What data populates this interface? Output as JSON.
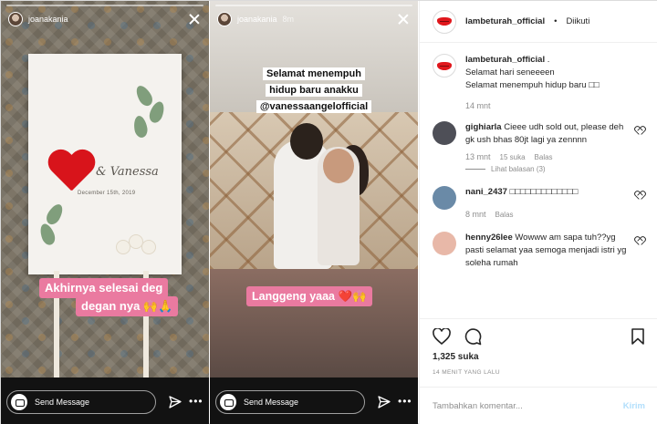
{
  "stories": [
    {
      "username": "joanakania",
      "time": "",
      "board_script": "& Vanessa",
      "board_date": "December 15th, 2019",
      "sticker_lines": [
        "Akhirnya selesai deg",
        "degan nya 🙌🙏"
      ],
      "reply_placeholder": "Send Message"
    },
    {
      "username": "joanakania",
      "time": "8m",
      "caption_lines": [
        "Selamat menempuh",
        "hidup baru anakku",
        "@vanessaangelofficial"
      ],
      "sticker": "Langgeng yaaa ❤️🙌",
      "reply_placeholder": "Send Message"
    }
  ],
  "post": {
    "author": "lambeturah_official",
    "dot": "•",
    "follow_label": "Diikuti",
    "caption_author": "lambeturah_official",
    "caption_lines": [
      ".",
      "Selamat hari seneeeen",
      "Selamat menempuh hidup baru □□"
    ],
    "caption_time": "14 mnt",
    "comments": [
      {
        "user": "gighiarla",
        "text": "Cieee udh sold out, please deh gk ush bhas 80jt lagi ya zennnn",
        "time": "13 mnt",
        "likes": "15 suka",
        "reply_label": "Balas",
        "view_replies": "Lihat balasan (3)",
        "avatar_color": "#4e4f57"
      },
      {
        "user": "nani_2437",
        "text": "□□□□□□□□□□□□□",
        "time": "8 mnt",
        "reply_label": "Balas",
        "avatar_color": "#6a8aa7"
      },
      {
        "user": "henny26lee",
        "text": "Wowww am sapa tuh??yg pasti selamat yaa semoga menjadi istri yg soleha rumah",
        "avatar_color": "#e8b8a8"
      }
    ],
    "likes": "1,325 suka",
    "time_ago": "14 MENIT YANG LALU",
    "comment_placeholder": "Tambahkan komentar...",
    "post_label": "Kirim"
  }
}
